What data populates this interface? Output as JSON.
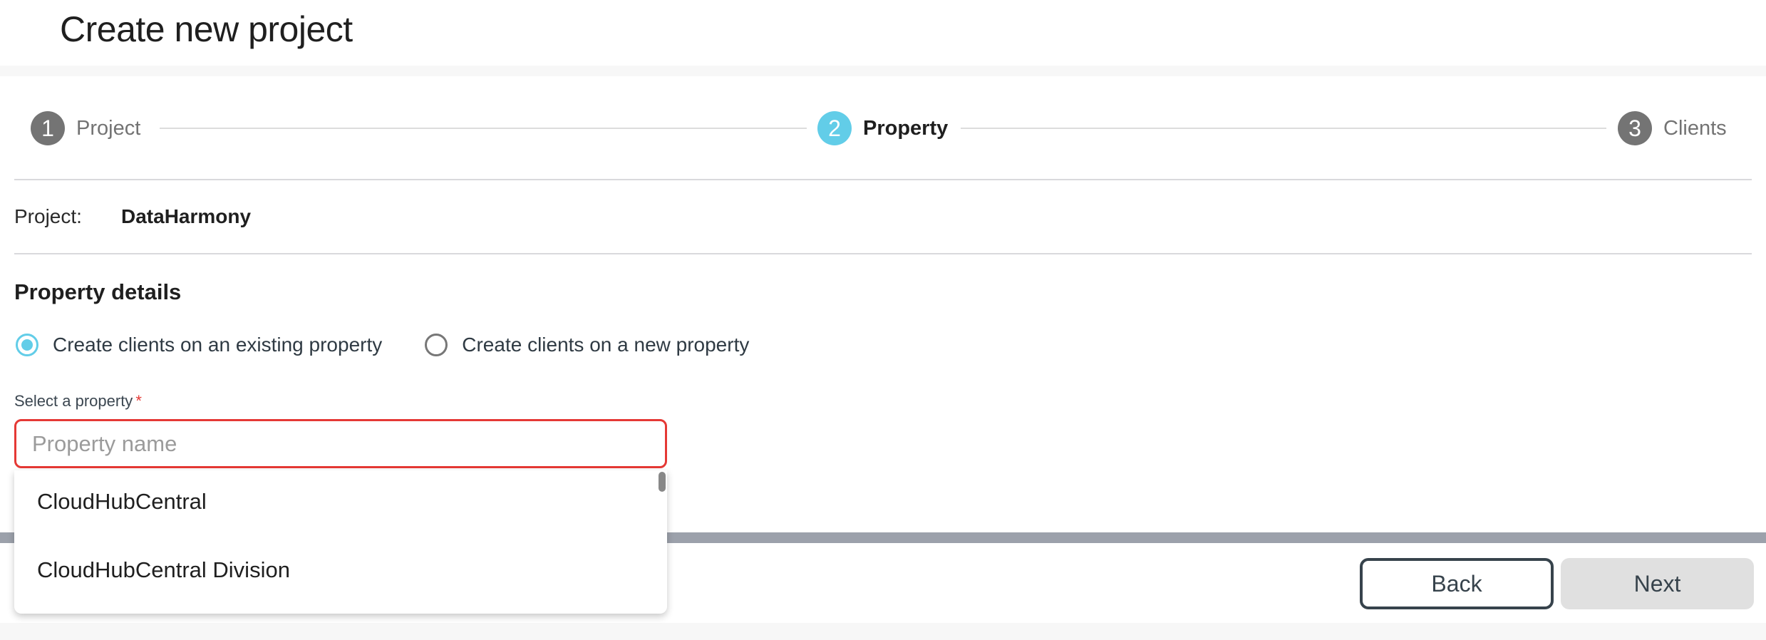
{
  "header": {
    "title": "Create new project"
  },
  "stepper": {
    "steps": [
      {
        "number": "1",
        "label": "Project",
        "state": "completed"
      },
      {
        "number": "2",
        "label": "Property",
        "state": "active"
      },
      {
        "number": "3",
        "label": "Clients",
        "state": "upcoming"
      }
    ],
    "active_color": "#62cde8",
    "inactive_color": "#747474"
  },
  "project": {
    "label": "Project:",
    "value": "DataHarmony"
  },
  "property_details": {
    "title": "Property details",
    "options": [
      {
        "label": "Create clients on an existing property",
        "checked": true
      },
      {
        "label": "Create clients on a new property",
        "checked": false
      }
    ],
    "select": {
      "label": "Select a property",
      "required_marker": "*",
      "value": "",
      "placeholder": "Property name",
      "error_color": "#e53935"
    },
    "dropdown_items": [
      "CloudHubCentral",
      "CloudHubCentral Division"
    ]
  },
  "footer": {
    "back_label": "Back",
    "next_label": "Next"
  }
}
